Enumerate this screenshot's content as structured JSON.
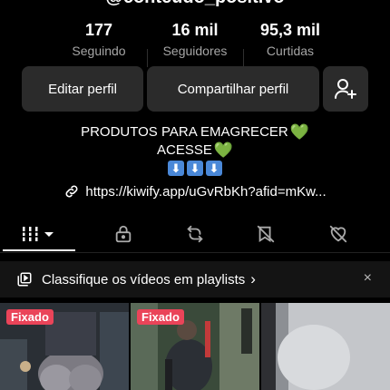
{
  "profile": {
    "username": "@conteudo_positivo"
  },
  "stats": [
    {
      "value": "177",
      "label": "Seguindo"
    },
    {
      "value": "16 mil",
      "label": "Seguidores"
    },
    {
      "value": "95,3 mil",
      "label": "Curtidas"
    }
  ],
  "actions": {
    "edit_label": "Editar perfil",
    "share_label": "Compartilhar perfil"
  },
  "bio": {
    "line1": "PRODUTOS PARA EMAGRECER",
    "line2": "ACESSE",
    "heart": "💚",
    "arrow": "⬇"
  },
  "link": {
    "text": "https://kiwify.app/uGvRbKh?afid=mKw..."
  },
  "banner": {
    "text": "Classifique os vídeos em playlists",
    "chevron": "›",
    "close": "×"
  },
  "videos": [
    {
      "badge": "Fixado"
    },
    {
      "badge": "Fixado"
    },
    {
      "badge": ""
    }
  ],
  "colors": {
    "background": "#000000",
    "button": "#2b2b2b",
    "badge": "#ea4459",
    "heart": "#49c43c",
    "arrow_box": "#4a88d8"
  },
  "icons": {
    "add_user": "add-user-icon",
    "link": "link-icon",
    "tab_videos": "grid-icon",
    "tab_private": "lock-icon",
    "tab_reposts": "repost-icon",
    "tab_favorites": "bookmark-icon",
    "tab_liked": "heart-icon",
    "playlist": "playlist-icon"
  }
}
